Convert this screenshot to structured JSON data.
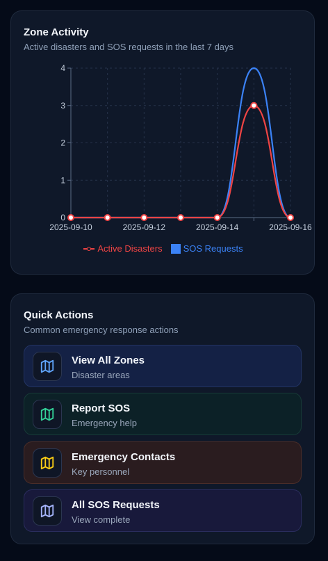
{
  "zone_activity": {
    "title": "Zone Activity",
    "subtitle": "Active disasters and SOS requests in the last 7 days"
  },
  "chart_data": {
    "type": "line",
    "x": [
      "2025-09-10",
      "2025-09-11",
      "2025-09-12",
      "2025-09-13",
      "2025-09-14",
      "2025-09-15",
      "2025-09-16"
    ],
    "x_tick_labels": [
      "2025-09-10",
      "2025-09-12",
      "2025-09-14",
      "2025-09-16"
    ],
    "y_ticks": [
      0,
      1,
      2,
      3,
      4
    ],
    "ylim": [
      0,
      4
    ],
    "grid": true,
    "legend_position": "bottom",
    "series": [
      {
        "name": "Active Disasters",
        "values": [
          0,
          0,
          0,
          0,
          0,
          3,
          0
        ],
        "color": "#ef4444",
        "markers": true
      },
      {
        "name": "SOS Requests",
        "values": [
          0,
          0,
          0,
          0,
          0,
          4,
          0
        ],
        "color": "#3b82f6",
        "markers": false
      }
    ]
  },
  "quick_actions": {
    "title": "Quick Actions",
    "subtitle": "Common emergency response actions",
    "items": [
      {
        "title": "View All Zones",
        "subtitle": "Disaster areas",
        "icon": "map-icon",
        "color": "#60a5fa"
      },
      {
        "title": "Report SOS",
        "subtitle": "Emergency help",
        "icon": "map-icon",
        "color": "#34d399"
      },
      {
        "title": "Emergency Contacts",
        "subtitle": "Key personnel",
        "icon": "map-icon",
        "color": "#facc15"
      },
      {
        "title": "All SOS Requests",
        "subtitle": "View complete",
        "icon": "map-icon",
        "color": "#a5b4fc"
      }
    ]
  }
}
